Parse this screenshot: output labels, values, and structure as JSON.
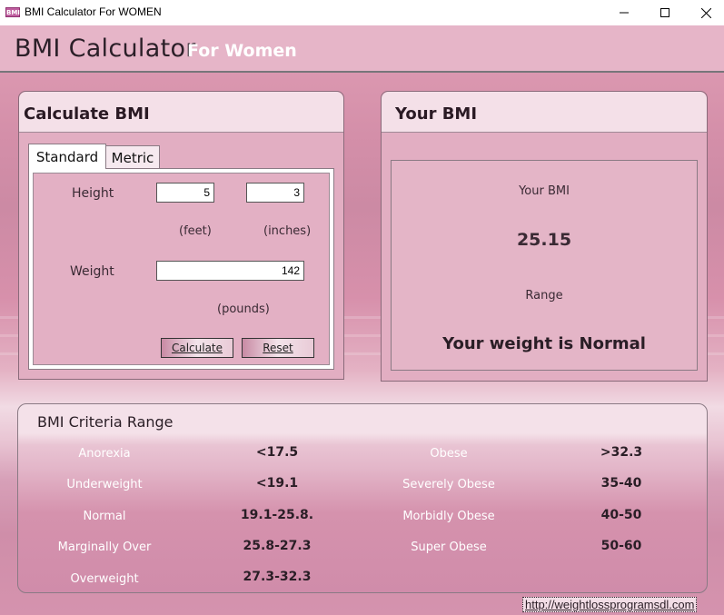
{
  "window": {
    "icon_text": "BMI",
    "title": "BMI Calculator For WOMEN"
  },
  "header": {
    "title": "BMI Calculator",
    "subtitle": "For Women"
  },
  "calculate": {
    "title": "Calculate BMI",
    "tabs": [
      {
        "label": "Standard",
        "active": true
      },
      {
        "label": "Metric",
        "active": false
      }
    ],
    "height_label": "Height",
    "height_feet": "5",
    "height_inches": "3",
    "feet_unit": "(feet)",
    "inches_unit": "(inches)",
    "weight_label": "Weight",
    "weight_value": "142",
    "pounds_unit": "(pounds)",
    "calculate_button": "Calculate",
    "reset_button": "Reset"
  },
  "result": {
    "title": "Your BMI",
    "bmi_label": "Your BMI",
    "bmi_value": "25.15",
    "range_label": "Range",
    "status": "Your weight is Normal"
  },
  "criteria": {
    "title": "BMI Criteria Range",
    "left": [
      {
        "name": "Anorexia",
        "range": "<17.5"
      },
      {
        "name": "Underweight",
        "range": "<19.1"
      },
      {
        "name": "Normal",
        "range": "19.1-25.8."
      },
      {
        "name": "Marginally Over",
        "range": "25.8-27.3"
      },
      {
        "name": "Overweight",
        "range": "27.3-32.3"
      }
    ],
    "right": [
      {
        "name": "Obese",
        "range": ">32.3"
      },
      {
        "name": "Severely Obese",
        "range": "35-40"
      },
      {
        "name": "Morbidly Obese",
        "range": "40-50"
      },
      {
        "name": "Super Obese",
        "range": "50-60"
      }
    ]
  },
  "footer": {
    "link": "http://weightlossprogramsdl.com"
  },
  "colors": {
    "accent": "#e6b5c8",
    "panel": "#e2aec2",
    "panel_header": "#f4e0e8"
  }
}
